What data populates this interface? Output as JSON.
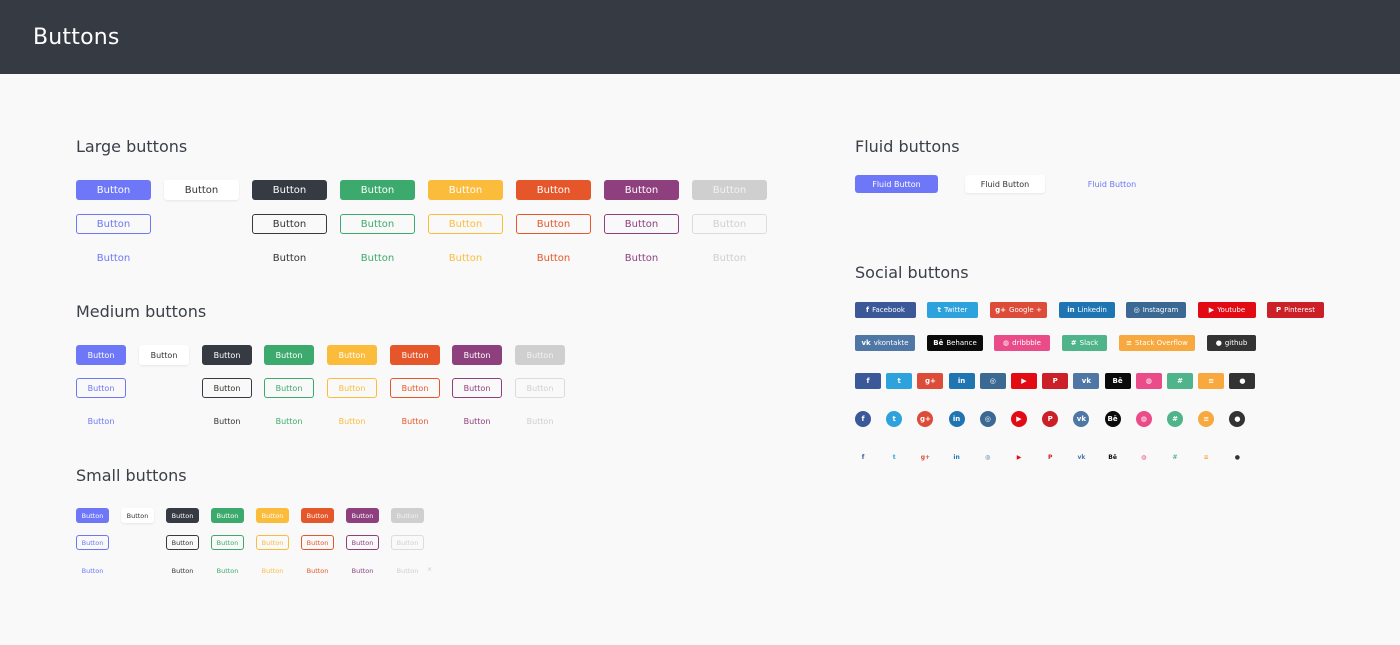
{
  "header": {
    "title": "Buttons"
  },
  "sections": {
    "large": "Large buttons",
    "medium": "Medium buttons",
    "small": "Small buttons",
    "fluid": "Fluid buttons",
    "social": "Social buttons"
  },
  "button_label": "Button",
  "colors": {
    "primary": "#6d77f7",
    "dark": "#353a43",
    "green": "#3caa6c",
    "yellow": "#fbbc3c",
    "orange": "#e5572a",
    "purple": "#8e3f7e",
    "light": "#cfcfcf"
  },
  "fluid": {
    "primary": "Fluid Button",
    "white": "Fluid Button",
    "link": "Fluid Button"
  },
  "social": {
    "facebook": "Facebook",
    "twitter": "Twitter",
    "google": "Google +",
    "linkedin": "Linkedin",
    "instagram": "Instagram",
    "youtube": "Youtube",
    "pinterest": "Pinterest",
    "vkontakte": "vkontakte",
    "behance": "Behance",
    "dribbble": "dribbble",
    "slack": "Slack",
    "stackoverflow": "Stack Overflow",
    "github": "github"
  },
  "social_colors": {
    "facebook": "#3b5998",
    "twitter": "#2ea2dc",
    "google": "#dd4b39",
    "linkedin": "#1f75b2",
    "instagram": "#3b6994",
    "youtube": "#e20b14",
    "pinterest": "#cb2027",
    "vkontakte": "#4e77a6",
    "behance": "#0b0b0b",
    "dribbble": "#ea4c89",
    "slack": "#4fb48a",
    "stackoverflow": "#f7a83e",
    "github": "#333333"
  },
  "icons": {
    "facebook": "f",
    "twitter": "t",
    "google": "g+",
    "linkedin": "in",
    "instagram": "◎",
    "youtube": "▶",
    "pinterest": "P",
    "vkontakte": "vk",
    "behance": "Bē",
    "dribbble": "◍",
    "slack": "#",
    "stackoverflow": "≡",
    "github": "●"
  },
  "close_icon": "×"
}
